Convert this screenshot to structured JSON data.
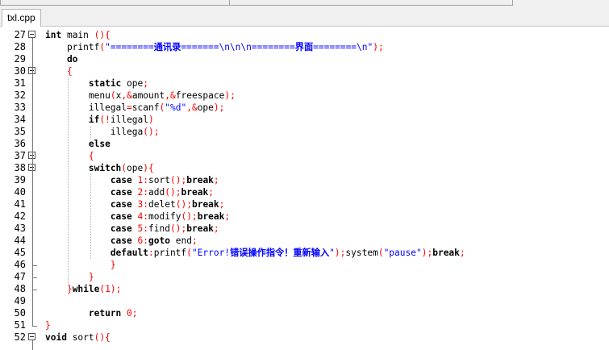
{
  "window": {
    "tab_label": "txl.cpp"
  },
  "editor": {
    "lines": [
      {
        "n": "27",
        "fold": "open",
        "segs": [
          [
            "kw",
            "int"
          ],
          [
            "t",
            " main "
          ],
          [
            "op",
            "("
          ],
          [
            "op",
            ")"
          ],
          [
            "op",
            "{"
          ]
        ]
      },
      {
        "n": "28",
        "fold": "",
        "segs": [
          [
            "t",
            "    printf"
          ],
          [
            "op",
            "("
          ],
          [
            "str",
            "\"========"
          ],
          [
            "strb",
            "通讯录"
          ],
          [
            "str",
            "=======\\n\\n\\n========"
          ],
          [
            "strb",
            "界面"
          ],
          [
            "str",
            "========\\n\""
          ],
          [
            "op",
            ")"
          ],
          [
            "op",
            ";"
          ]
        ]
      },
      {
        "n": "29",
        "fold": "",
        "segs": [
          [
            "kw",
            "    do"
          ]
        ]
      },
      {
        "n": "30",
        "fold": "open",
        "segs": [
          [
            "op",
            "    {"
          ]
        ]
      },
      {
        "n": "31",
        "fold": "",
        "segs": [
          [
            "kw",
            "        static"
          ],
          [
            "t",
            " ope"
          ],
          [
            "op",
            ";"
          ]
        ]
      },
      {
        "n": "32",
        "fold": "",
        "segs": [
          [
            "t",
            "        menu"
          ],
          [
            "op",
            "("
          ],
          [
            "t",
            "x"
          ],
          [
            "op",
            ","
          ],
          [
            "op",
            "&"
          ],
          [
            "t",
            "amount"
          ],
          [
            "op",
            ","
          ],
          [
            "op",
            "&"
          ],
          [
            "t",
            "freespace"
          ],
          [
            "op",
            ")"
          ],
          [
            "op",
            ";"
          ]
        ]
      },
      {
        "n": "33",
        "fold": "",
        "segs": [
          [
            "t",
            "        illegal"
          ],
          [
            "op",
            "="
          ],
          [
            "t",
            "scanf"
          ],
          [
            "op",
            "("
          ],
          [
            "str",
            "\"%d\""
          ],
          [
            "op",
            ","
          ],
          [
            "op",
            "&"
          ],
          [
            "t",
            "ope"
          ],
          [
            "op",
            ")"
          ],
          [
            "op",
            ";"
          ]
        ]
      },
      {
        "n": "34",
        "fold": "",
        "segs": [
          [
            "kw",
            "        if"
          ],
          [
            "op",
            "("
          ],
          [
            "op",
            "!"
          ],
          [
            "t",
            "illegal"
          ],
          [
            "op",
            ")"
          ]
        ]
      },
      {
        "n": "35",
        "fold": "",
        "segs": [
          [
            "t",
            "            illega"
          ],
          [
            "op",
            "("
          ],
          [
            "op",
            ")"
          ],
          [
            "op",
            ";"
          ]
        ]
      },
      {
        "n": "36",
        "fold": "",
        "segs": [
          [
            "kw",
            "        else"
          ]
        ]
      },
      {
        "n": "37",
        "fold": "open",
        "segs": [
          [
            "op",
            "        {"
          ]
        ]
      },
      {
        "n": "38",
        "fold": "open",
        "segs": [
          [
            "kw",
            "        switch"
          ],
          [
            "op",
            "("
          ],
          [
            "t",
            "ope"
          ],
          [
            "op",
            ")"
          ],
          [
            "op",
            "{"
          ]
        ]
      },
      {
        "n": "39",
        "fold": "",
        "segs": [
          [
            "kw",
            "            case"
          ],
          [
            "t",
            " "
          ],
          [
            "num",
            "1"
          ],
          [
            "op",
            ":"
          ],
          [
            "t",
            "sort"
          ],
          [
            "op",
            "("
          ],
          [
            "op",
            ")"
          ],
          [
            "op",
            ";"
          ],
          [
            "kw",
            "break"
          ],
          [
            "op",
            ";"
          ]
        ]
      },
      {
        "n": "40",
        "fold": "",
        "segs": [
          [
            "kw",
            "            case"
          ],
          [
            "t",
            " "
          ],
          [
            "num",
            "2"
          ],
          [
            "op",
            ":"
          ],
          [
            "t",
            "add"
          ],
          [
            "op",
            "("
          ],
          [
            "op",
            ")"
          ],
          [
            "op",
            ";"
          ],
          [
            "kw",
            "break"
          ],
          [
            "op",
            ";"
          ]
        ]
      },
      {
        "n": "41",
        "fold": "",
        "segs": [
          [
            "kw",
            "            case"
          ],
          [
            "t",
            " "
          ],
          [
            "num",
            "3"
          ],
          [
            "op",
            ":"
          ],
          [
            "t",
            "delet"
          ],
          [
            "op",
            "("
          ],
          [
            "op",
            ")"
          ],
          [
            "op",
            ";"
          ],
          [
            "kw",
            "break"
          ],
          [
            "op",
            ";"
          ]
        ]
      },
      {
        "n": "42",
        "fold": "",
        "segs": [
          [
            "kw",
            "            case"
          ],
          [
            "t",
            " "
          ],
          [
            "num",
            "4"
          ],
          [
            "op",
            ":"
          ],
          [
            "t",
            "modify"
          ],
          [
            "op",
            "("
          ],
          [
            "op",
            ")"
          ],
          [
            "op",
            ";"
          ],
          [
            "kw",
            "break"
          ],
          [
            "op",
            ";"
          ]
        ]
      },
      {
        "n": "43",
        "fold": "",
        "segs": [
          [
            "kw",
            "            case"
          ],
          [
            "t",
            " "
          ],
          [
            "num",
            "5"
          ],
          [
            "op",
            ":"
          ],
          [
            "t",
            "find"
          ],
          [
            "op",
            "("
          ],
          [
            "op",
            ")"
          ],
          [
            "op",
            ";"
          ],
          [
            "kw",
            "break"
          ],
          [
            "op",
            ";"
          ]
        ]
      },
      {
        "n": "44",
        "fold": "",
        "segs": [
          [
            "kw",
            "            case"
          ],
          [
            "t",
            " "
          ],
          [
            "num",
            "6"
          ],
          [
            "op",
            ":"
          ],
          [
            "kw",
            "goto"
          ],
          [
            "t",
            " end"
          ],
          [
            "op",
            ";"
          ]
        ]
      },
      {
        "n": "45",
        "fold": "",
        "segs": [
          [
            "kw",
            "            default"
          ],
          [
            "op",
            ":"
          ],
          [
            "t",
            "printf"
          ],
          [
            "op",
            "("
          ],
          [
            "str",
            "\"Error!"
          ],
          [
            "strb",
            "错误操作指令！重新输入"
          ],
          [
            "str",
            "\""
          ],
          [
            "op",
            ")"
          ],
          [
            "op",
            ";"
          ],
          [
            "t",
            "system"
          ],
          [
            "op",
            "("
          ],
          [
            "str",
            "\"pause\""
          ],
          [
            "op",
            ")"
          ],
          [
            "op",
            ";"
          ],
          [
            "kw",
            "break"
          ],
          [
            "op",
            ";"
          ]
        ]
      },
      {
        "n": "46",
        "fold": "end",
        "segs": [
          [
            "op",
            "            }"
          ]
        ]
      },
      {
        "n": "47",
        "fold": "end",
        "segs": [
          [
            "op",
            "        }"
          ]
        ]
      },
      {
        "n": "48",
        "fold": "end",
        "segs": [
          [
            "op",
            "    }"
          ],
          [
            "kw",
            "while"
          ],
          [
            "op",
            "("
          ],
          [
            "num",
            "1"
          ],
          [
            "op",
            ")"
          ],
          [
            "op",
            ";"
          ]
        ]
      },
      {
        "n": "49",
        "fold": "",
        "segs": []
      },
      {
        "n": "50",
        "fold": "",
        "segs": [
          [
            "kw",
            "        return"
          ],
          [
            "t",
            " "
          ],
          [
            "num",
            "0"
          ],
          [
            "op",
            ";"
          ]
        ]
      },
      {
        "n": "51",
        "fold": "end",
        "segs": [
          [
            "op",
            "}"
          ]
        ]
      },
      {
        "n": "52",
        "fold": "open",
        "segs": [
          [
            "kw",
            "void"
          ],
          [
            "t",
            " sort"
          ],
          [
            "op",
            "("
          ],
          [
            "op",
            ")"
          ],
          [
            "op",
            "{"
          ]
        ]
      }
    ]
  }
}
